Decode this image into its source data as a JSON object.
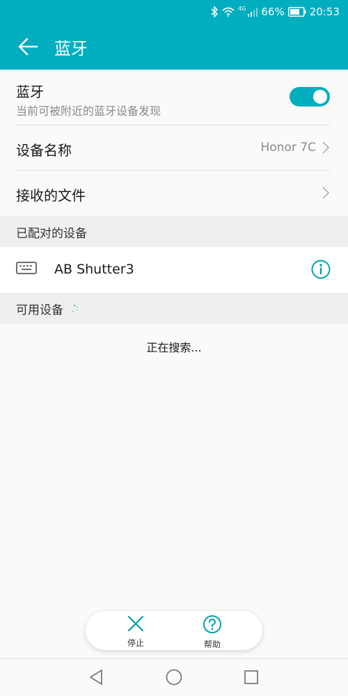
{
  "status_bar": {
    "network": "4G",
    "battery": "66%",
    "time": "20:53",
    "icons": [
      "bluetooth-icon",
      "wifi-icon",
      "signal-icon",
      "battery-icon"
    ]
  },
  "app_bar": {
    "title": "蓝牙",
    "back_icon": "arrow-left-icon",
    "color": "#00aebf"
  },
  "bluetooth": {
    "title": "蓝牙",
    "subtitle": "当前可被附近的蓝牙设备发现",
    "enabled": true
  },
  "device_name": {
    "label": "设备名称",
    "value": "Honor 7C"
  },
  "received_files": {
    "label": "接收的文件"
  },
  "paired_section": {
    "title": "已配对的设备",
    "devices": [
      {
        "name": "AB Shutter3",
        "icon": "keyboard-icon",
        "action_icon": "info-icon"
      }
    ]
  },
  "available_section": {
    "title": "可用设备",
    "status": "正在搜索..."
  },
  "bottom_actions": {
    "stop_label": "停止",
    "help_label": "帮助"
  },
  "nav_bar": {
    "icons": [
      "back-triangle-icon",
      "home-circle-icon",
      "recents-square-icon"
    ]
  }
}
